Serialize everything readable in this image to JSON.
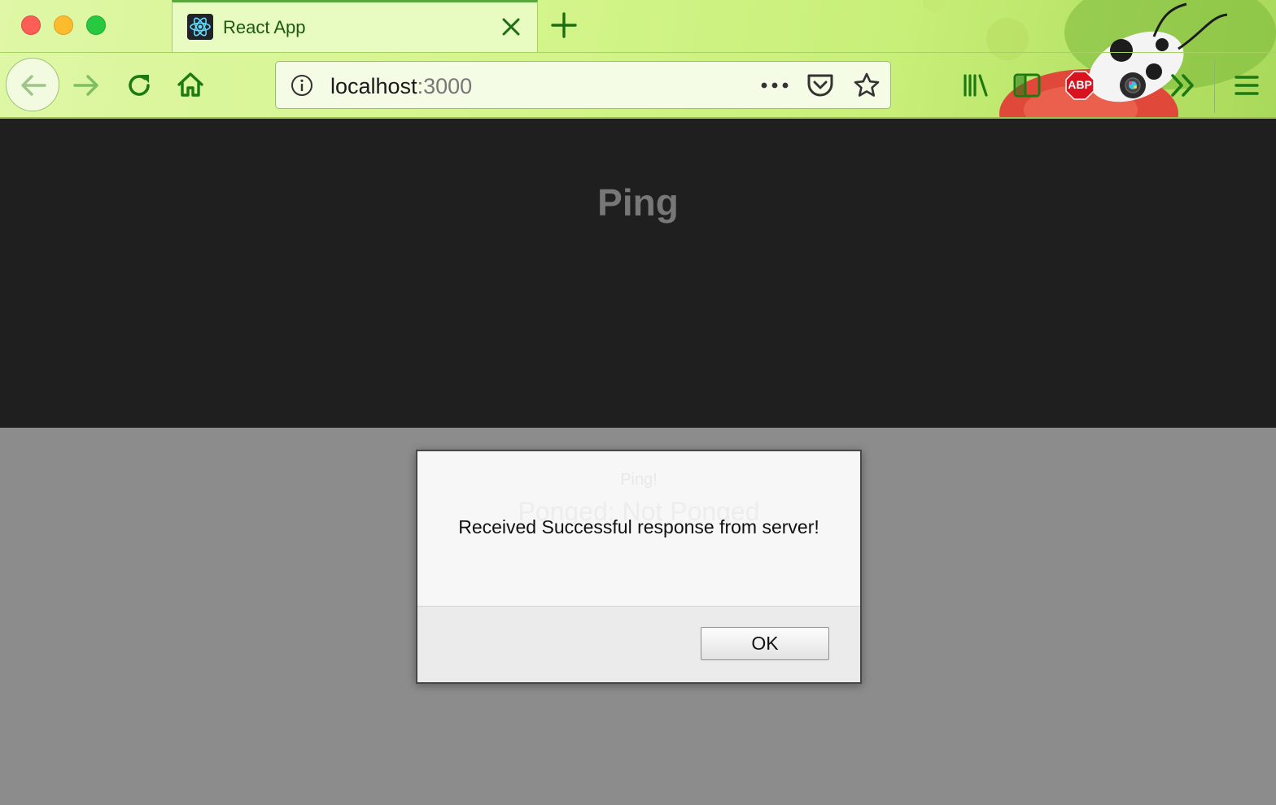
{
  "browser": {
    "tab": {
      "title": "React App",
      "favicon": "react-icon",
      "close_icon": "close-icon"
    },
    "new_tab_icon": "plus-icon",
    "nav": {
      "back_icon": "arrow-left-icon",
      "forward_icon": "arrow-right-icon",
      "reload_icon": "reload-icon",
      "home_icon": "home-icon"
    },
    "url": {
      "host": "localhost",
      "port": ":3000",
      "info_icon": "info-icon",
      "page_actions_icon": "more-horizontal-icon",
      "pocket_icon": "pocket-icon",
      "bookmark_icon": "star-icon"
    },
    "toolbar": {
      "library_icon": "library-icon",
      "sidebar_icon": "sidebar-icon",
      "adblock_label": "ABP",
      "camera_icon": "camera-icon",
      "overflow_icon": "chevron-double-right-icon",
      "menu_icon": "hamburger-menu-icon"
    },
    "theme_colors": {
      "accent": "#1d7a12",
      "chrome": "#d4f58c"
    }
  },
  "page": {
    "title": "Ping",
    "behind_dialog_button": "Ping!",
    "behind_dialog_status": "Ponged: Not Ponged"
  },
  "dialog": {
    "message": "Received Successful response from server!",
    "ok_label": "OK"
  }
}
